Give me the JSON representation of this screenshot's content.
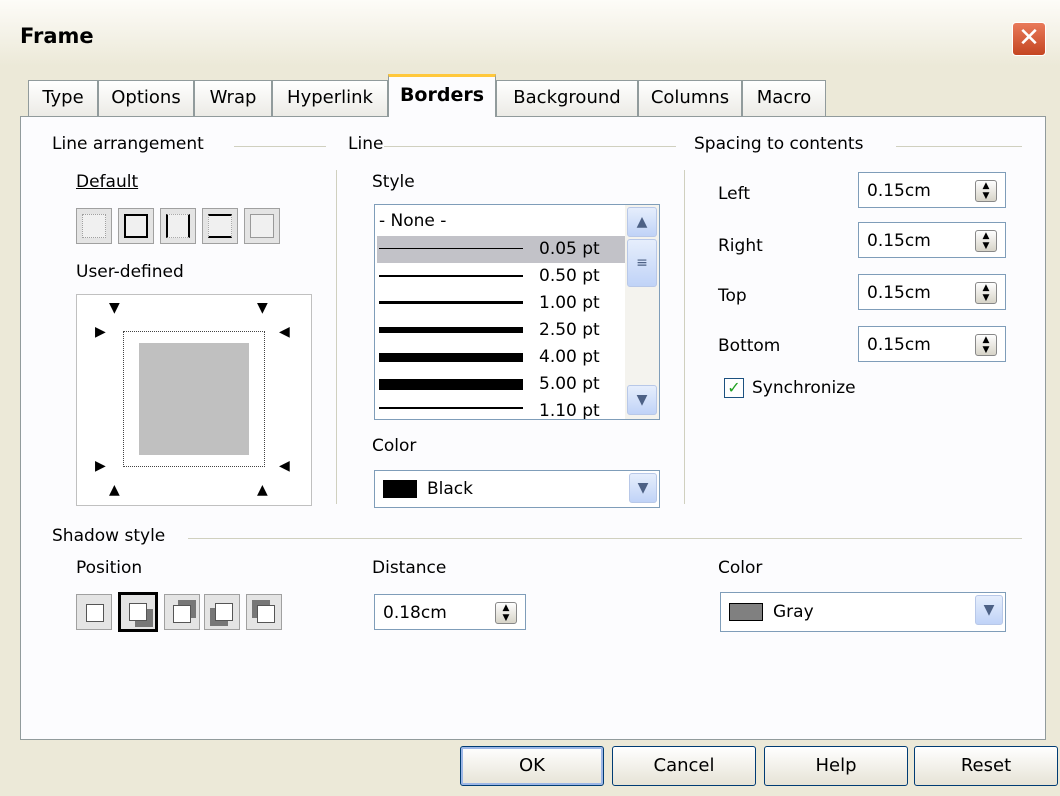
{
  "window": {
    "title": "Frame",
    "close_glyph": "✕"
  },
  "tabs": [
    "Type",
    "Options",
    "Wrap",
    "Hyperlink",
    "Borders",
    "Background",
    "Columns",
    "Macro"
  ],
  "active_tab": "Borders",
  "line_arrangement": {
    "heading": "Line arrangement",
    "default_label": "Default",
    "user_defined_label": "User-defined"
  },
  "line": {
    "heading": "Line",
    "style_label": "Style",
    "styles": [
      "- None -",
      "0.05 pt",
      "0.50 pt",
      "1.00 pt",
      "2.50 pt",
      "4.00 pt",
      "5.00 pt",
      "1.10 pt"
    ],
    "selected_style": "0.05 pt",
    "color_label": "Color",
    "color_value": "Black",
    "color_hex": "#000000"
  },
  "spacing": {
    "heading": "Spacing to contents",
    "left_label": "Left",
    "left_value": "0.15cm",
    "right_label": "Right",
    "right_value": "0.15cm",
    "top_label": "Top",
    "top_value": "0.15cm",
    "bottom_label": "Bottom",
    "bottom_value": "0.15cm",
    "synchronize_label": "Synchronize",
    "synchronize_checked": true
  },
  "shadow": {
    "heading": "Shadow style",
    "position_label": "Position",
    "distance_label": "Distance",
    "distance_value": "0.18cm",
    "color_label": "Color",
    "color_value": "Gray",
    "color_hex": "#808080"
  },
  "buttons": {
    "ok": "OK",
    "cancel": "Cancel",
    "help": "Help",
    "reset": "Reset"
  },
  "icons": [
    "close-icon",
    "scroll-up-icon",
    "scroll-down-icon",
    "dropdown-arrow-icon",
    "spin-icon",
    "checkmark-icon"
  ]
}
